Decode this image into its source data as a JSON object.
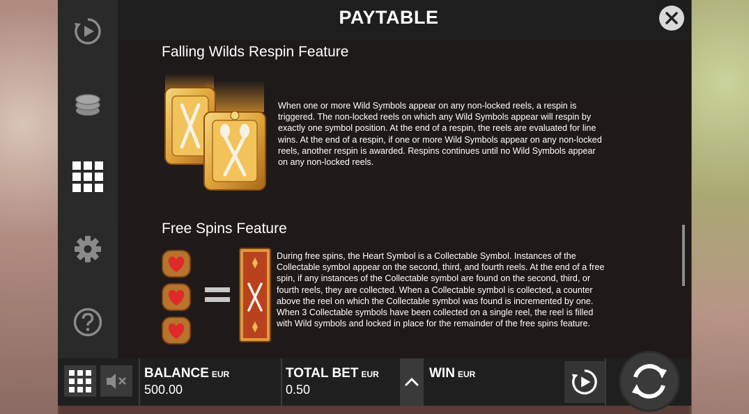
{
  "header": {
    "title": "PAYTABLE"
  },
  "sidebar": {
    "items": [
      {
        "name": "autoplay-icon"
      },
      {
        "name": "coins-icon"
      },
      {
        "name": "paytable-grid-icon"
      },
      {
        "name": "gear-icon"
      },
      {
        "name": "help-icon"
      }
    ]
  },
  "sections": {
    "falling_wilds": {
      "title": "Falling Wilds Respin Feature",
      "text": "When one or more Wild Symbols appear on any non-locked reels, a respin is triggered. The non-locked reels on which any Wild Symbols appear will respin by exactly one symbol position. At the end of a respin, the reels are evaluated for line wins. At the end of a respin, if one or more Wild Symbols appear on any non-locked reels, another respin is awarded. Respins continues until no Wild Symbols appear on any non-locked reels."
    },
    "free_spins": {
      "title": "Free Spins Feature",
      "text": "During free spins, the Heart Symbol is a Collectable Symbol. Instances of the Collectable symbol appear on the second, third, and fourth reels. At the end of a free spin, if any instances of the Collectable symbol are found on the second, third, or fourth reels, they are collected. When a Collectable symbol is collected, a counter above the reel on which the Collectable symbol was found is incremented by one. When 3 Collectable symbols have been collected on a single reel, the reel is filled with Wild symbols and locked in place for the remainder of the free spins feature."
    }
  },
  "bottom": {
    "balance_label": "BALANCE",
    "balance_unit": "EUR",
    "balance_value": "500.00",
    "bet_label": "TOTAL BET",
    "bet_unit": "EUR",
    "bet_value": "0.50",
    "win_label": "WIN",
    "win_unit": "EUR"
  },
  "colors": {
    "gold": "#e0a43a",
    "heart_red": "#e02a2a",
    "panel_bg": "#1f1a1a"
  }
}
